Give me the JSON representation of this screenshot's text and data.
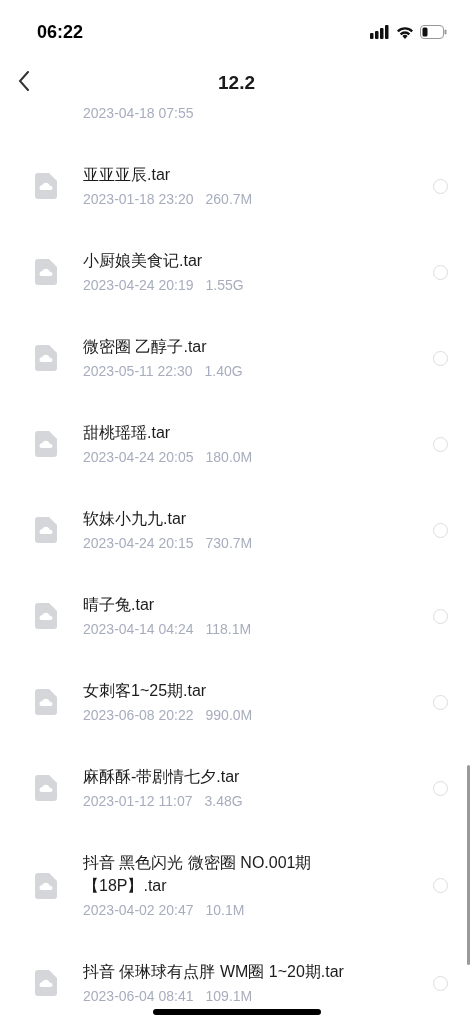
{
  "status_bar": {
    "time": "06:22"
  },
  "header": {
    "title": "12.2"
  },
  "partial_item": {
    "meta": "2023-04-18 07:55"
  },
  "files": [
    {
      "name": "亚亚亚辰.tar",
      "date": "2023-01-18 23:20",
      "size": "260.7M",
      "selected": false
    },
    {
      "name": "小厨娘美食记.tar",
      "date": "2023-04-24 20:19",
      "size": "1.55G",
      "selected": false
    },
    {
      "name": "微密圈 乙醇子.tar",
      "date": "2023-05-11 22:30",
      "size": "1.40G",
      "selected": false
    },
    {
      "name": "甜桃瑶瑶.tar",
      "date": "2023-04-24 20:05",
      "size": "180.0M",
      "selected": false
    },
    {
      "name": "软妹小九九.tar",
      "date": "2023-04-24 20:15",
      "size": "730.7M",
      "selected": false
    },
    {
      "name": "晴子兔.tar",
      "date": "2023-04-14 04:24",
      "size": "118.1M",
      "selected": false
    },
    {
      "name": "女刺客1~25期.tar",
      "date": "2023-06-08 20:22",
      "size": "990.0M",
      "selected": false
    },
    {
      "name": "麻酥酥-带剧情七夕.tar",
      "date": "2023-01-12 11:07",
      "size": "3.48G",
      "selected": false
    },
    {
      "name": "抖音 黑色闪光 微密圈  NO.001期【18P】.tar",
      "date": "2023-04-02 20:47",
      "size": "10.1M",
      "selected": false
    },
    {
      "name": "抖音 保琳球有点胖 WM圈 1~20期.tar",
      "date": "2023-06-04 08:41",
      "size": "109.1M",
      "selected": false
    }
  ]
}
